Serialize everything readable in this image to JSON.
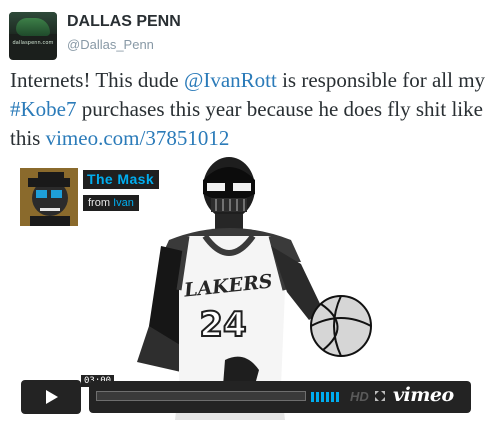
{
  "tweet": {
    "author": {
      "name": "DALLAS PENN",
      "handle": "@Dallas_Penn",
      "avatar_text": "dallaspenn.com"
    },
    "text": {
      "part1": "Internets! This dude ",
      "mention": "@IvanRott",
      "part2": " is responsible for all my ",
      "hashtag": "#Kobe7",
      "part3": " purchases this year because he does fly shit like this ",
      "link": "vimeo.com/37851012"
    },
    "link_color": "#2b7bb9"
  },
  "video": {
    "title": "The Mask",
    "from_word": "from",
    "from_user": "Ivan",
    "duration": "03:00",
    "progress": 0,
    "hd_label": "HD",
    "logo": "vimeo",
    "jersey_team": "LAKERS",
    "jersey_number": "24",
    "accent_color": "#00adef",
    "icons": [
      "play-icon",
      "volume-icon",
      "fullscreen-icon"
    ]
  }
}
